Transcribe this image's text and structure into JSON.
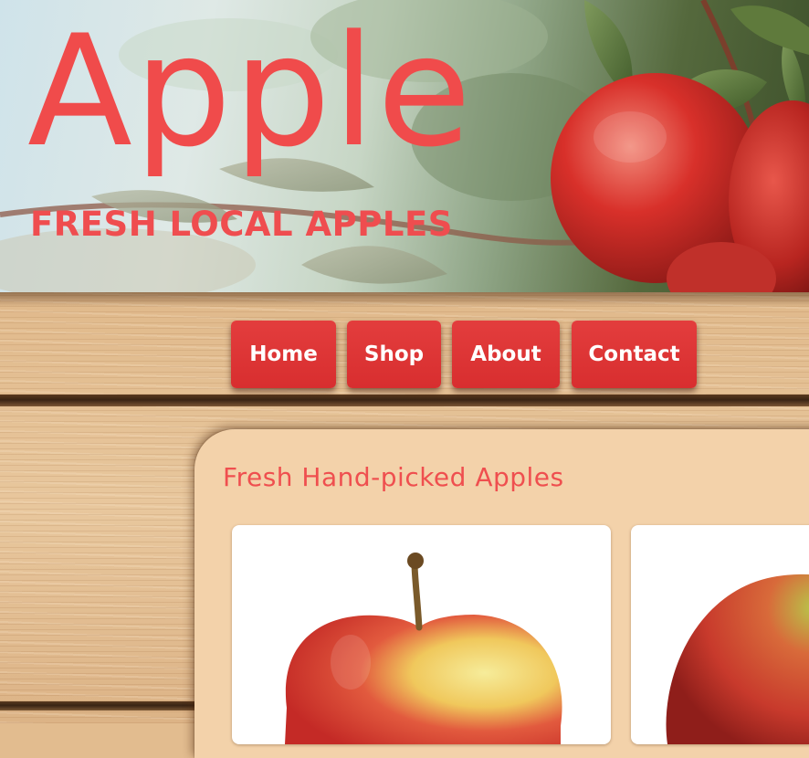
{
  "brand": {
    "title": "Apple",
    "tagline": "FRESH LOCAL APPLES"
  },
  "nav": {
    "items": [
      {
        "label": "Home"
      },
      {
        "label": "Shop"
      },
      {
        "label": "About"
      },
      {
        "label": "Contact"
      }
    ]
  },
  "main": {
    "heading": "Fresh Hand-picked Apples",
    "products": [
      {
        "image": "red-yellow-apple-image"
      },
      {
        "image": "red-green-apple-image"
      }
    ]
  },
  "colors": {
    "accent_red": "#e03535",
    "title_red": "#f04b4b",
    "wood": "#e2bc8f",
    "panel": "#f3d2aa",
    "card": "#ffffff"
  }
}
